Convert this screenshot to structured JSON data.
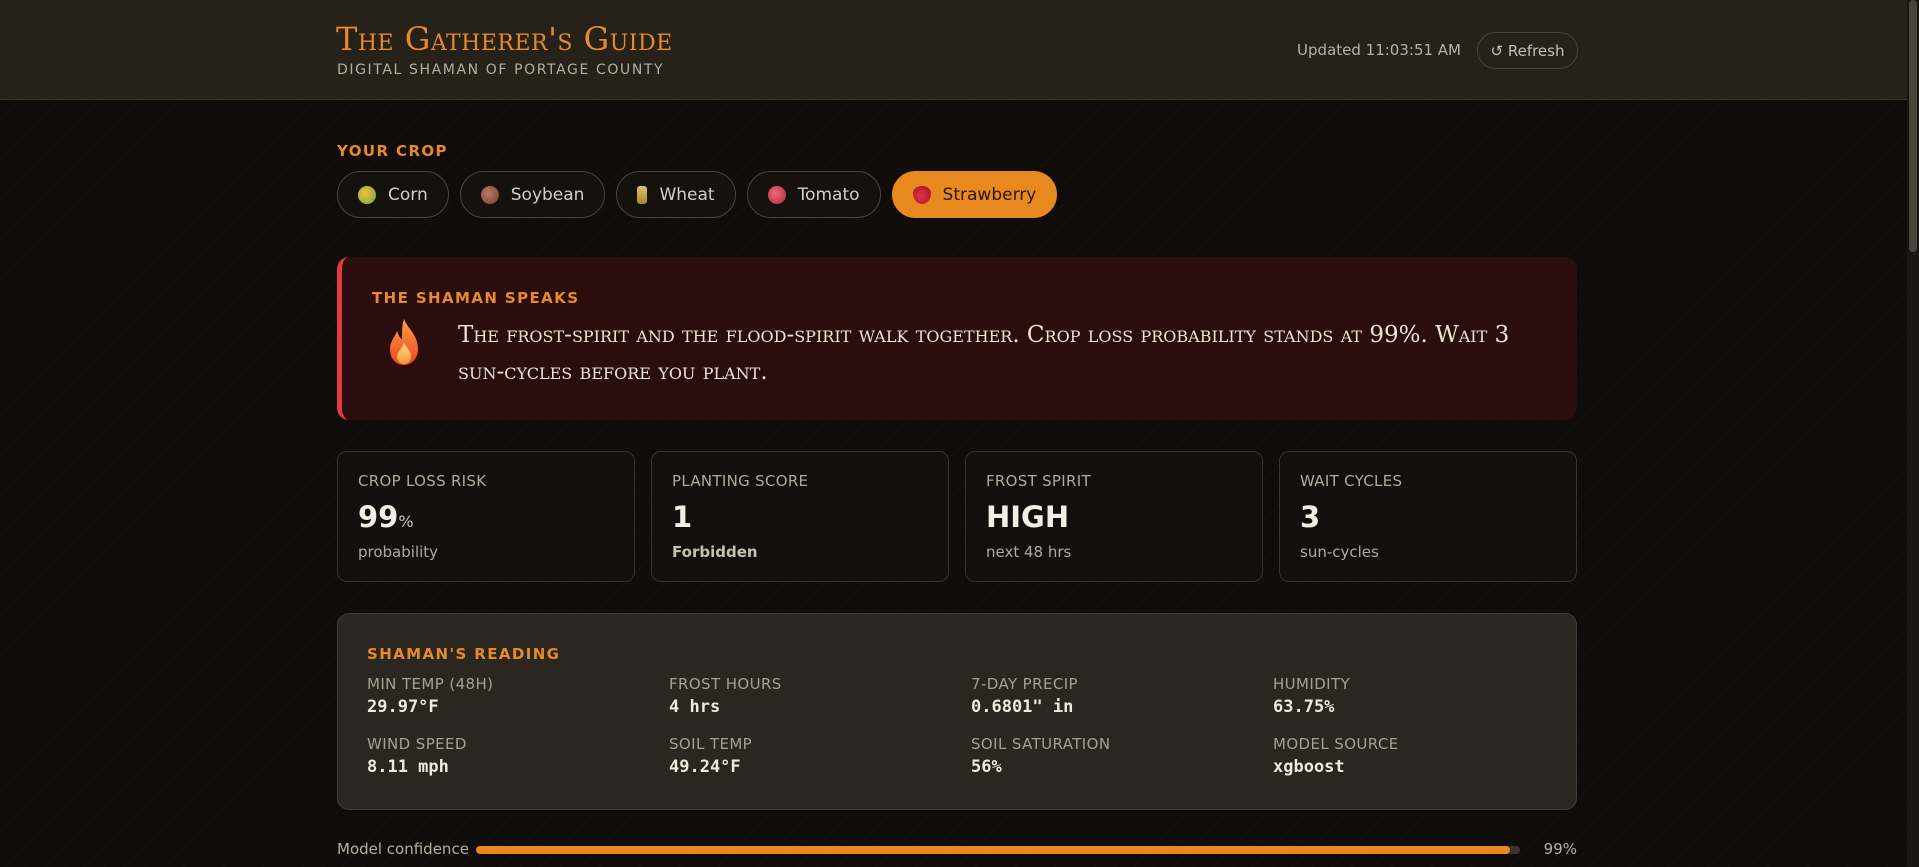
{
  "header": {
    "title": "The Gatherer's Guide",
    "subtitle": "DIGITAL SHAMAN OF PORTAGE COUNTY",
    "updated": "Updated 11:03:51 AM",
    "refresh_label": "↺ Refresh"
  },
  "crop": {
    "label": "YOUR CROP",
    "options": [
      {
        "label": "Corn",
        "icon": "corn-icon",
        "color": "#d4a82c",
        "active": false
      },
      {
        "label": "Soybean",
        "icon": "soybean-icon",
        "color": "#9b5a4a",
        "active": false
      },
      {
        "label": "Wheat",
        "icon": "wheat-icon",
        "color": "#c9a24a",
        "active": false
      },
      {
        "label": "Tomato",
        "icon": "tomato-icon",
        "color": "#d9455a",
        "active": false
      },
      {
        "label": "Strawberry",
        "icon": "strawberry-icon",
        "color": "#c8102e",
        "active": true
      }
    ]
  },
  "shaman": {
    "label": "THE SHAMAN SPEAKS",
    "message": "The frost-spirit and the flood-spirit walk together. Crop loss probability stands at 99%. Wait 3 sun-cycles before you plant."
  },
  "stats": [
    {
      "label": "CROP LOSS RISK",
      "value": "99",
      "unit": "%",
      "sub": "probability",
      "sub_bold": false
    },
    {
      "label": "PLANTING SCORE",
      "value": "1",
      "unit": "",
      "sub": "Forbidden",
      "sub_bold": true
    },
    {
      "label": "FROST SPIRIT",
      "value": "HIGH",
      "unit": "",
      "sub": "next 48 hrs",
      "sub_bold": false
    },
    {
      "label": "WAIT CYCLES",
      "value": "3",
      "unit": "",
      "sub": "sun-cycles",
      "sub_bold": false
    }
  ],
  "reading": {
    "label": "SHAMAN'S READING",
    "items": [
      {
        "label": "MIN TEMP (48H)",
        "value": "29.97°F"
      },
      {
        "label": "FROST HOURS",
        "value": "4 hrs"
      },
      {
        "label": "7-DAY PRECIP",
        "value": "0.6801\" in"
      },
      {
        "label": "HUMIDITY",
        "value": "63.75%"
      },
      {
        "label": "WIND SPEED",
        "value": "8.11 mph"
      },
      {
        "label": "SOIL TEMP",
        "value": "49.24°F"
      },
      {
        "label": "SOIL SATURATION",
        "value": "56%"
      },
      {
        "label": "MODEL SOURCE",
        "value": "xgboost"
      }
    ]
  },
  "confidence": {
    "label": "Model confidence",
    "percent_text": "99%",
    "value": 0.99
  },
  "colors": {
    "accent": "#e8891f",
    "alert": "#e23c3c"
  }
}
